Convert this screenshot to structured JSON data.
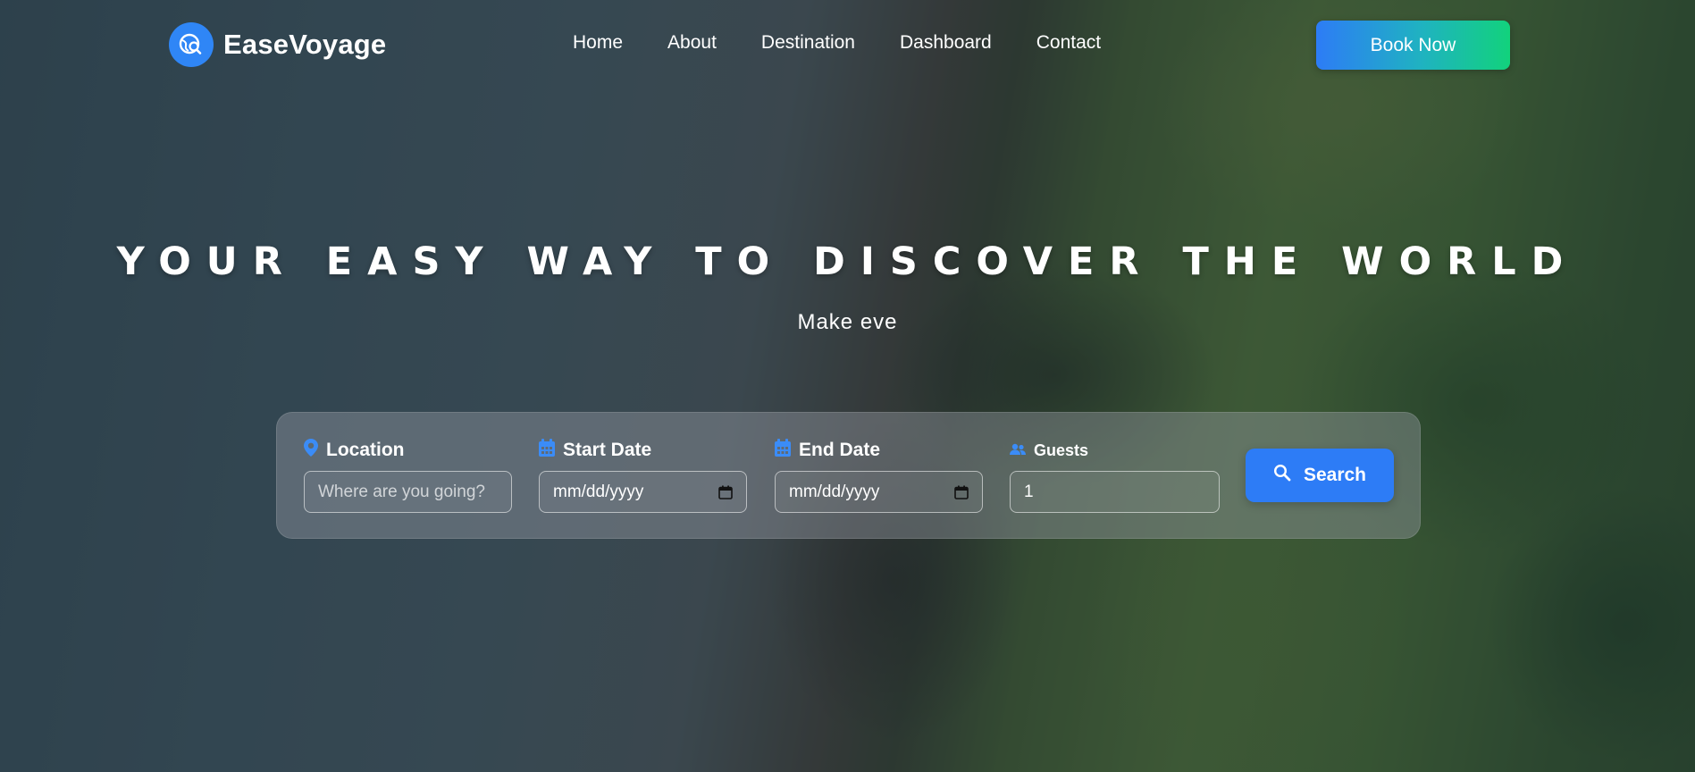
{
  "brand": {
    "name": "EaseVoyage",
    "accent": "#2f86f6"
  },
  "nav": {
    "links": [
      "Home",
      "About",
      "Destination",
      "Dashboard",
      "Contact"
    ],
    "cta_label": "Book Now"
  },
  "hero": {
    "title": "YOUR EASY WAY TO DISCOVER THE WORLD",
    "subtitle": "Make eve"
  },
  "search": {
    "location": {
      "label": "Location",
      "placeholder": "Where are you going?",
      "icon": "map-pin-icon"
    },
    "start_date": {
      "label": "Start Date",
      "value": "mm/dd/yyyy",
      "icon": "calendar-icon"
    },
    "end_date": {
      "label": "End Date",
      "value": "mm/dd/yyyy",
      "icon": "calendar-icon"
    },
    "guests": {
      "label": "Guests",
      "value": "1",
      "icon": "users-icon"
    },
    "button_label": "Search"
  }
}
